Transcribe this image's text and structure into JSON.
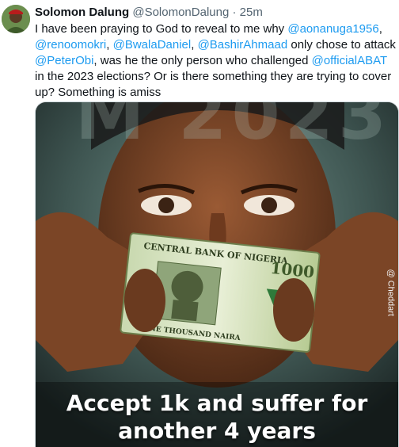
{
  "tweet": {
    "author_name": "Solomon Dalung",
    "author_handle": "@SolomonDalung",
    "separator": "·",
    "time": "25m",
    "text_segments": [
      {
        "t": "I have been praying to God to reveal to me why ",
        "mention": false
      },
      {
        "t": "@aonanuga1956",
        "mention": true
      },
      {
        "t": ", ",
        "mention": false
      },
      {
        "t": "@renoomokri",
        "mention": true
      },
      {
        "t": ", ",
        "mention": false
      },
      {
        "t": "@BwalaDaniel",
        "mention": true
      },
      {
        "t": ", ",
        "mention": false
      },
      {
        "t": "@BashirAhmaad",
        "mention": true
      },
      {
        "t": " only chose to attack ",
        "mention": false
      },
      {
        "t": "@PeterObi",
        "mention": true
      },
      {
        "t": ", was he the only person who challenged ",
        "mention": false
      },
      {
        "t": "@officialABAT",
        "mention": true
      },
      {
        "t": " in the 2023 elections? Or is there something they are trying to cover up? Something is amiss",
        "mention": false
      }
    ],
    "image": {
      "caption_line1": "Accept 1k and suffer for",
      "caption_line2": "another 4 years",
      "banknote_text": "CENTRAL BANK OF NIGERIA",
      "banknote_denomination": "1000",
      "banknote_bottom_text": "ONE THOUSAND NAIRA",
      "watermark": "@ Cheddart",
      "background_text": "M 2023"
    }
  },
  "colors": {
    "mention": "#1d9bf0",
    "text": "#0f1419",
    "muted": "#536471"
  }
}
